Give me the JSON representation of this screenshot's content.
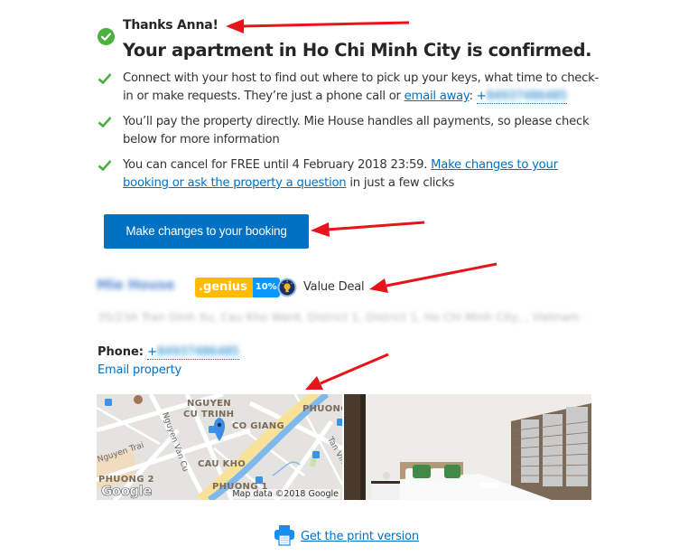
{
  "header": {
    "greeting": "Thanks Anna!",
    "headline": "Your apartment in Ho Chi Minh City is confirmed."
  },
  "bullets": [
    {
      "text_before": "Connect with your host to find out where to pick up your keys, what time to check-in or make requests. They’re just a phone call or ",
      "link": "email away",
      "text_after": ": ",
      "phone_prefix": "+",
      "phone_blurred": "84937486485"
    },
    {
      "text": "You’ll pay the property directly. Mie House handles all payments, so please check below for more information"
    },
    {
      "text_before": "You can cancel for FREE until 4 February 2018 23:59. ",
      "link": "Make changes to your booking or ask the property a question",
      "text_after": " in just a few clicks"
    }
  ],
  "cta": {
    "label": "Make changes to your booking"
  },
  "property": {
    "name_blurred": "Mie House",
    "genius_label": ".genius",
    "genius_discount": "10%",
    "deal_label": "Value Deal",
    "address_blurred": "35/23A Tran Dinh Xu, Cau Kho Ward, District 1, District 1, Ho Chi Minh City, , Vietnam -",
    "phone_label": "Phone:",
    "phone_prefix": "+",
    "phone_blurred": "84937486485",
    "email_link": "Email property"
  },
  "map": {
    "labels": [
      "NGUYEN",
      "CU TRINH",
      "CO GIANG",
      "CAU KHO",
      "PHUONG",
      "PHUONG 2",
      "PHUONG 1"
    ],
    "streets": [
      "Nguyen Trai",
      "Nguyen Van Cu",
      "Tan Vinh"
    ],
    "attribution": "Map data ©2018 Google",
    "logo": "Google"
  },
  "photo": {
    "alt": "Bedroom with white bed, green pillows and wooden blinds"
  },
  "print": {
    "label": "Get the print version"
  },
  "colors": {
    "accent": "#0071c2",
    "success": "#4caf3f",
    "genius_yellow": "#febb02",
    "genius_blue": "#0896ff",
    "annotation_arrow": "#e8141b"
  }
}
